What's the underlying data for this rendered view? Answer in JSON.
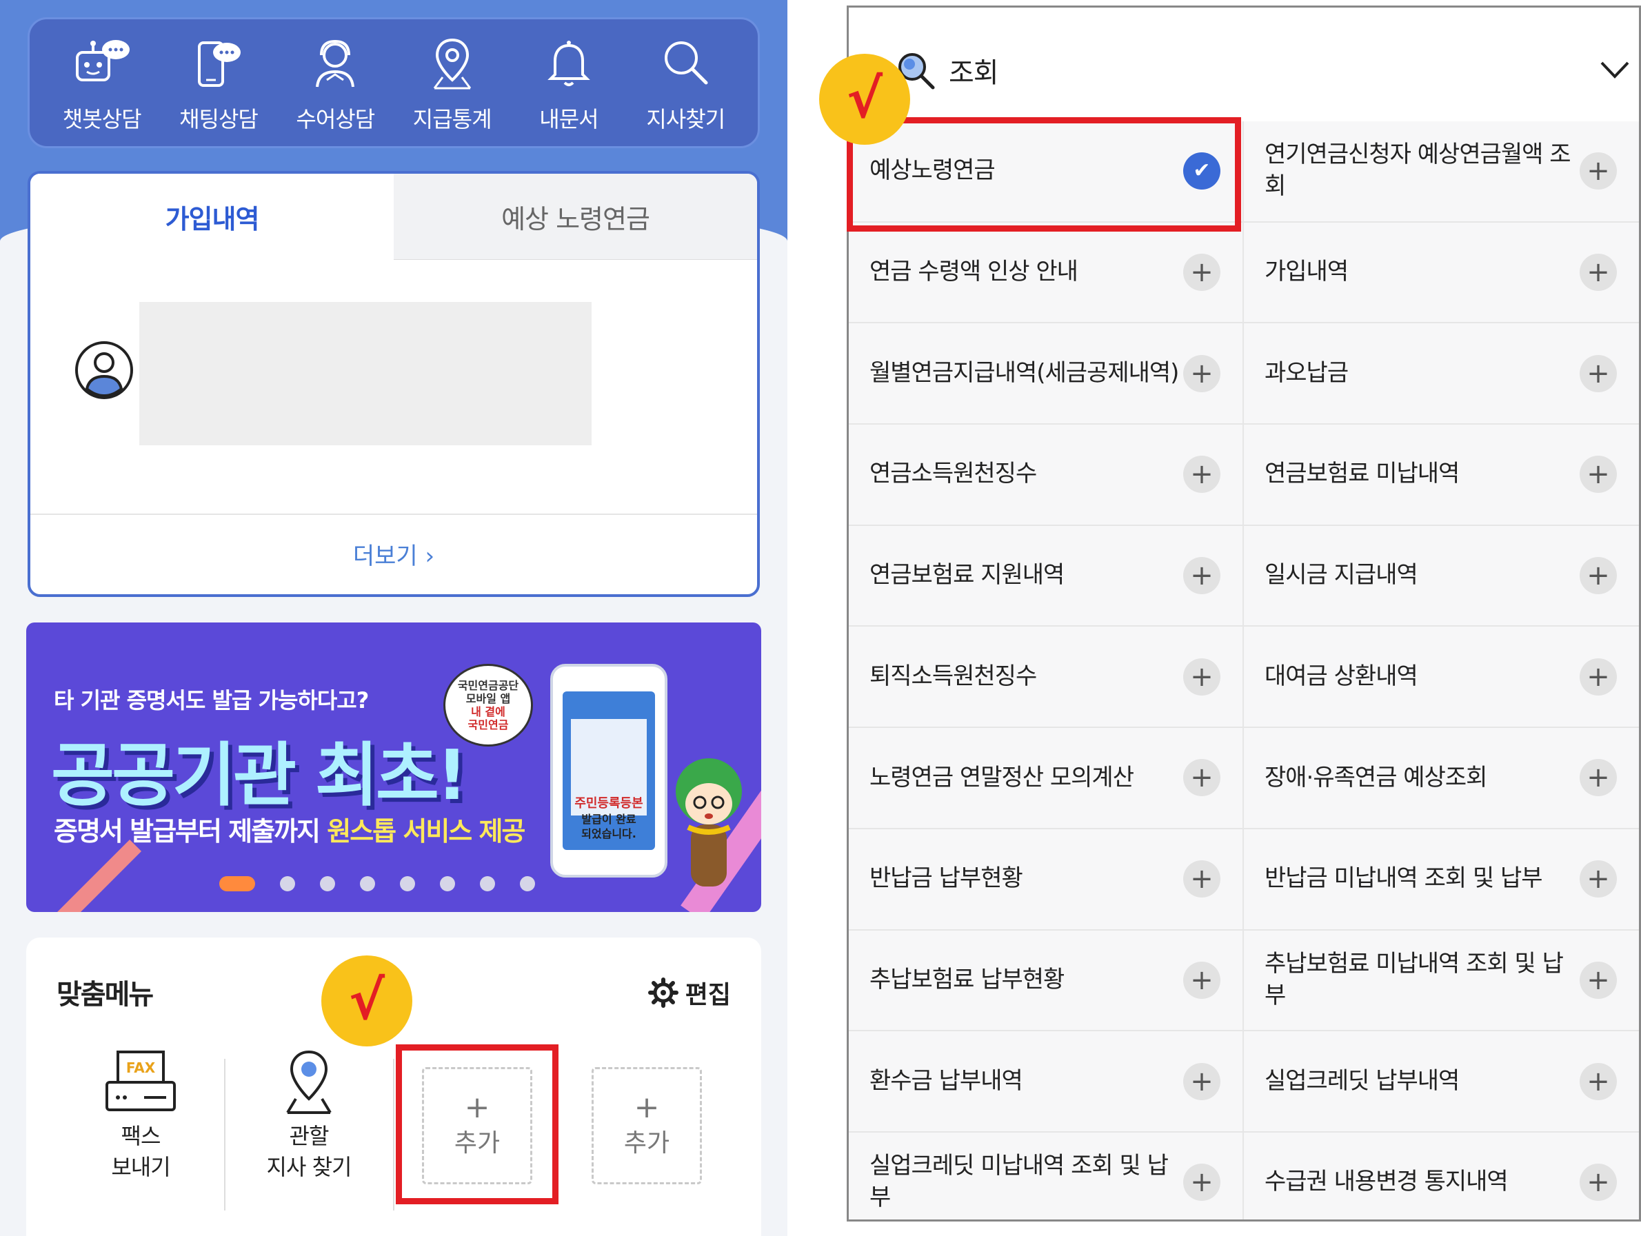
{
  "quick_menu": [
    {
      "icon": "chatbot-icon",
      "label": "챗봇상담"
    },
    {
      "icon": "chat-phone-icon",
      "label": "채팅상담"
    },
    {
      "icon": "sign-language-icon",
      "label": "수어상담"
    },
    {
      "icon": "location-pin-icon",
      "label": "지급통계"
    },
    {
      "icon": "bell-icon",
      "label": "내문서"
    },
    {
      "icon": "search-icon",
      "label": "지사찾기"
    }
  ],
  "info_card": {
    "tab_active": "가입내역",
    "tab_inactive": "예상 노령연금",
    "more_label": "더보기 ›"
  },
  "banner": {
    "question": "타 기관 증명서도 발급 가능하다고?",
    "headline": "공공기관 최초!",
    "sub_prefix": "증명서 발급부터 제출까지 ",
    "sub_highlight": "원스톱 서비스 제공",
    "badge_line1": "국민연금공단",
    "badge_line2": "모바일 앱",
    "badge_line3": "내 곁에",
    "badge_line4": "국민연금",
    "phone_line1": "주민등록등본",
    "phone_line2": "발급이 완료",
    "phone_line3": "되었습니다.",
    "slide_count": 8,
    "active_slide": 0
  },
  "custom_menu": {
    "title": "맞춤메뉴",
    "edit_label": "편집",
    "tiles": [
      {
        "icon": "fax-icon",
        "label": "팩스\n보내기"
      },
      {
        "icon": "branch-pin-icon",
        "label": "관할\n지사 찾기"
      }
    ],
    "add_label": "추가",
    "add_plus": "+"
  },
  "annotations": {
    "check_mark": "√",
    "highlight_color": "#e31e24",
    "check_bg": "#f9c21a"
  },
  "lookup_panel": {
    "title": "조회",
    "items": [
      {
        "label": "예상노령연금",
        "selected": true
      },
      {
        "label": "연기연금신청자 예상연금월액 조회",
        "selected": false
      },
      {
        "label": "연금 수령액 인상 안내",
        "selected": false
      },
      {
        "label": "가입내역",
        "selected": false
      },
      {
        "label": "월별연금지급내역(세금공제내역)",
        "selected": false
      },
      {
        "label": "과오납금",
        "selected": false
      },
      {
        "label": "연금소득원천징수",
        "selected": false
      },
      {
        "label": "연금보험료 미납내역",
        "selected": false
      },
      {
        "label": "연금보험료 지원내역",
        "selected": false
      },
      {
        "label": "일시금 지급내역",
        "selected": false
      },
      {
        "label": "퇴직소득원천징수",
        "selected": false
      },
      {
        "label": "대여금 상환내역",
        "selected": false
      },
      {
        "label": "노령연금 연말정산 모의계산",
        "selected": false
      },
      {
        "label": "장애·유족연금 예상조회",
        "selected": false
      },
      {
        "label": "반납금 납부현황",
        "selected": false
      },
      {
        "label": "반납금 미납내역 조회 및 납부",
        "selected": false
      },
      {
        "label": "추납보험료 납부현황",
        "selected": false
      },
      {
        "label": "추납보험료 미납내역 조회 및 납부",
        "selected": false
      },
      {
        "label": "환수금 납부내역",
        "selected": false
      },
      {
        "label": "실업크레딧 납부내역",
        "selected": false
      },
      {
        "label": "실업크레딧 미납내역 조회 및 납부",
        "selected": false
      },
      {
        "label": "수급권 내용변경 통지내역",
        "selected": false
      }
    ],
    "add_symbol": "+",
    "check_symbol": "✔"
  }
}
